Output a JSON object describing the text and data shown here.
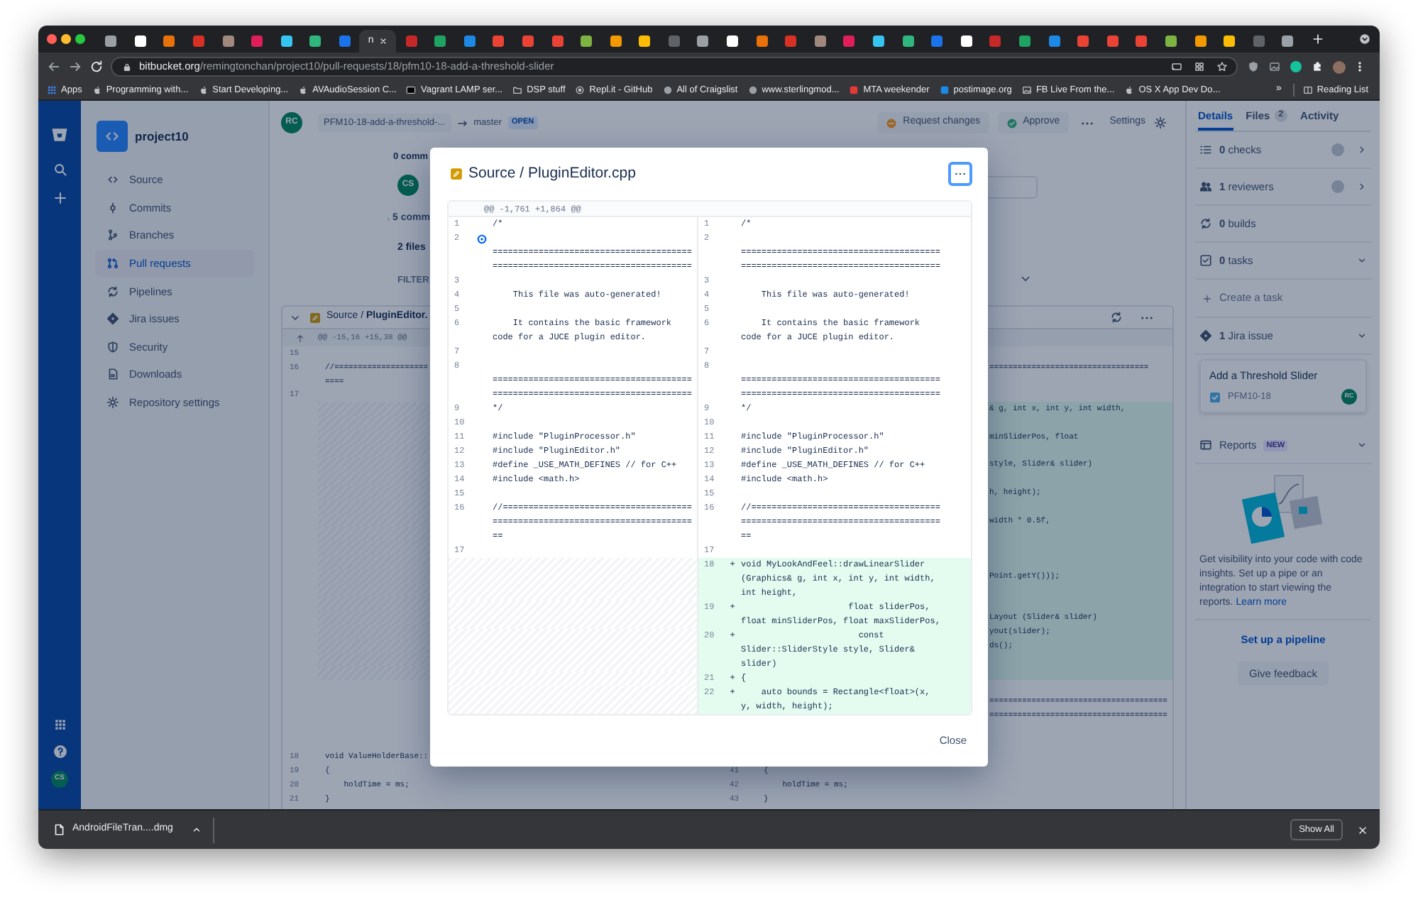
{
  "browser": {
    "tabs": [
      {
        "selected": false
      },
      {
        "selected": false
      },
      {
        "selected": false
      },
      {
        "selected": false
      },
      {
        "selected": false
      },
      {
        "selected": false
      },
      {
        "selected": false
      },
      {
        "selected": false
      },
      {
        "selected": false
      },
      {
        "selected": true,
        "label": "n"
      },
      {
        "selected": false
      },
      {
        "selected": false
      },
      {
        "selected": false
      },
      {
        "selected": false
      },
      {
        "selected": false
      },
      {
        "selected": false
      },
      {
        "selected": false
      },
      {
        "selected": false
      },
      {
        "selected": false
      },
      {
        "selected": false
      },
      {
        "selected": false
      },
      {
        "selected": false
      },
      {
        "selected": false
      },
      {
        "selected": false
      },
      {
        "selected": false
      },
      {
        "selected": false
      },
      {
        "selected": false
      },
      {
        "selected": false
      },
      {
        "selected": false
      },
      {
        "selected": false
      },
      {
        "selected": false
      },
      {
        "selected": false
      },
      {
        "selected": false
      },
      {
        "selected": false
      },
      {
        "selected": false
      },
      {
        "selected": false
      },
      {
        "selected": false
      },
      {
        "selected": false
      },
      {
        "selected": false
      },
      {
        "selected": false
      },
      {
        "selected": false
      }
    ],
    "url_host": "bitbucket.org",
    "url_path": "/remingtonchan/project10/pull-requests/18/pfm10-18-add-a-threshold-slider",
    "bookmarks": [
      {
        "label": "Apps",
        "kind": "apps"
      },
      {
        "label": "Programming with...",
        "kind": "apple"
      },
      {
        "label": "Start Developing...",
        "kind": "apple"
      },
      {
        "label": "AVAudioSession C...",
        "kind": "apple"
      },
      {
        "label": "Vagrant LAMP ser...",
        "kind": "box"
      },
      {
        "label": "DSP stuff",
        "kind": "folder"
      },
      {
        "label": "Repl.it - GitHub",
        "kind": "circle"
      },
      {
        "label": "All of Craigslist",
        "kind": "globe"
      },
      {
        "label": "www.sterlingmod...",
        "kind": "globe"
      },
      {
        "label": "MTA weekender",
        "kind": "red"
      },
      {
        "label": "postimage.org",
        "kind": "blue"
      },
      {
        "label": "FB Live From the...",
        "kind": "image"
      },
      {
        "label": "OS X App Dev Do...",
        "kind": "apple"
      }
    ],
    "bookmarks_more": "»",
    "reading_list": "Reading List"
  },
  "nav_rail": {
    "avatar": "CS"
  },
  "sidebar": {
    "project": "project10",
    "items": [
      {
        "label": "Source",
        "kind": "source",
        "selected": false
      },
      {
        "label": "Commits",
        "kind": "commits",
        "selected": false
      },
      {
        "label": "Branches",
        "kind": "branches",
        "selected": false
      },
      {
        "label": "Pull requests",
        "kind": "pull_requests",
        "selected": true
      },
      {
        "label": "Pipelines",
        "kind": "pipelines",
        "selected": false
      },
      {
        "label": "Jira issues",
        "kind": "jira",
        "selected": false
      },
      {
        "label": "Security",
        "kind": "security",
        "selected": false
      },
      {
        "label": "Downloads",
        "kind": "downloads",
        "selected": false
      },
      {
        "label": "Repository settings",
        "kind": "settings",
        "selected": false
      }
    ]
  },
  "pr_header": {
    "author_avatar": "RC",
    "source_branch": "PFM10-18-add-a-threshold-...",
    "target_branch": "master",
    "state": "OPEN",
    "request_changes": "Request changes",
    "approve": "Approve",
    "settings": "Settings"
  },
  "summary": {
    "comments": "0 comm",
    "avatar": "CS",
    "commits": "5 comm",
    "files": "2 files",
    "filter": "FILTER"
  },
  "file_diff": {
    "path": "Source / **PluginEditor.**",
    "hunk": "@@ -15,16 +15,38 @@",
    "rows": [
      {
        "old_no": "15",
        "added": false
      },
      {
        "old_no": "16",
        "old_text": "//====================",
        "new_text": "==================================",
        "kind": "tail",
        "added": false
      },
      {
        "old_text": "====",
        "added": false
      },
      {
        "old_no": "17",
        "added": false
      },
      {
        "new_text": "& g, int x, int y, int width,",
        "kind": "tail",
        "added": true
      },
      {
        "added": true
      },
      {
        "new_text": "minSliderPos, float",
        "kind": "tail",
        "added": true
      },
      {
        "added": true
      },
      {
        "new_text": "style, Slider& slider)",
        "kind": "tail",
        "added": true
      },
      {
        "added": true
      },
      {
        "new_text": "h, height);",
        "kind": "tail",
        "added": true
      },
      {
        "added": true
      },
      {
        "new_text": "width * 0.5f,",
        "kind": "tail",
        "added": true
      },
      {
        "added": true
      },
      {
        "added": true
      },
      {
        "added": true
      },
      {
        "new_text": "Point.getY()));",
        "kind": "tail",
        "added": true
      },
      {
        "added": true
      },
      {
        "added": true
      },
      {
        "new_text": "Layout (Slider& slider)",
        "kind": "tail",
        "added": true
      },
      {
        "new_text": "yout(slider);",
        "kind": "tail",
        "added": true
      },
      {
        "new_text": "ds();",
        "kind": "tail",
        "added": true
      },
      {
        "added": true
      },
      {
        "added": true
      },
      {
        "added": false
      },
      {
        "new_text": "======================================",
        "kind": "tail",
        "added": false
      },
      {
        "new_text": "======================================",
        "kind": "tail",
        "added": false
      },
      {
        "added": false
      },
      {
        "added": false
      },
      {
        "old_no": "18",
        "old_text": "void ValueHolderBase::",
        "added": false
      },
      {
        "old_no": "19",
        "old_text": "{",
        "new_no": "41",
        "new_text": "{",
        "kind": "full",
        "added": false
      },
      {
        "old_no": "20",
        "old_text": "    holdTime = ms;",
        "new_no": "42",
        "new_text": "    holdTime = ms;",
        "kind": "full",
        "added": false
      },
      {
        "old_no": "21",
        "old_text": "}",
        "new_no": "43",
        "new_text": "}",
        "kind": "full",
        "added": false
      }
    ]
  },
  "details_panel": {
    "tabs": [
      {
        "label": "Details",
        "selected": true
      },
      {
        "label": "Files",
        "count": "2",
        "selected": false
      },
      {
        "label": "Activity",
        "selected": false
      }
    ],
    "items": [
      {
        "kind": "checks",
        "text": "**0** checks",
        "indicator": true,
        "expanded": false
      },
      {
        "kind": "reviewers",
        "text": "**1** reviewers",
        "indicator": true,
        "expanded": false
      },
      {
        "kind": "builds",
        "text": "**0** builds",
        "indicator": false
      },
      {
        "kind": "tasks",
        "text": "**0** tasks",
        "indicator": false,
        "expanded": true
      }
    ],
    "create_task": "Create a task",
    "jira": {
      "text": "**1** Jira issue",
      "expanded": true,
      "title": "Add a Threshold Slider",
      "key": "PFM10-18",
      "avatar": "RC"
    },
    "reports": {
      "label": "Reports",
      "badge": "NEW",
      "expanded": true,
      "description": "Get visibility into your code with code insights. Set up a pipe or an integration to start viewing the reports.",
      "link": "Learn more",
      "pipeline_link": "Set up a pipeline",
      "feedback": "Give feedback"
    }
  },
  "modal": {
    "title": "Source / PluginEditor.cpp",
    "hunk": "@@ -1,761 +1,864 @@",
    "close": "Close",
    "rows": [
      {
        "old_no": "1",
        "old_text": "/*",
        "new_no": "1",
        "new_text": "/*",
        "added": false,
        "marker": false
      },
      {
        "old_no": "2",
        "old_text": "  ==============================================================================",
        "new_no": "2",
        "new_text": "  ==============================================================================",
        "added": false,
        "marker": true
      },
      {
        "old_no": "3",
        "new_no": "3",
        "added": false,
        "marker": false
      },
      {
        "old_no": "4",
        "old_text": "    This file was auto-generated!",
        "new_no": "4",
        "new_text": "    This file was auto-generated!",
        "added": false,
        "marker": false
      },
      {
        "old_no": "5",
        "new_no": "5",
        "added": false,
        "marker": false
      },
      {
        "old_no": "6",
        "old_text": "    It contains the basic framework code for a JUCE plugin editor.",
        "new_no": "6",
        "new_text": "    It contains the basic framework code for a JUCE plugin editor.",
        "added": false,
        "marker": false
      },
      {
        "old_no": "7",
        "new_no": "7",
        "added": false,
        "marker": false
      },
      {
        "old_no": "8",
        "old_text": "  ==============================================================================",
        "new_no": "8",
        "new_text": "  ==============================================================================",
        "added": false,
        "marker": false
      },
      {
        "old_no": "9",
        "old_text": "*/",
        "new_no": "9",
        "new_text": "*/",
        "added": false,
        "marker": false
      },
      {
        "old_no": "10",
        "new_no": "10",
        "added": false,
        "marker": false
      },
      {
        "old_no": "11",
        "old_text": "#include \"PluginProcessor.h\"",
        "new_no": "11",
        "new_text": "#include \"PluginProcessor.h\"",
        "added": false,
        "marker": false
      },
      {
        "old_no": "12",
        "old_text": "#include \"PluginEditor.h\"",
        "new_no": "12",
        "new_text": "#include \"PluginEditor.h\"",
        "added": false,
        "marker": false
      },
      {
        "old_no": "13",
        "old_text": "#define _USE_MATH_DEFINES // for C++",
        "new_no": "13",
        "new_text": "#define _USE_MATH_DEFINES // for C++",
        "added": false,
        "marker": false
      },
      {
        "old_no": "14",
        "old_text": "#include <math.h>",
        "new_no": "14",
        "new_text": "#include <math.h>",
        "added": false,
        "marker": false
      },
      {
        "old_no": "15",
        "new_no": "15",
        "added": false,
        "marker": false
      },
      {
        "old_no": "16",
        "old_text": "//==============================================================================",
        "new_no": "16",
        "new_text": "//==============================================================================",
        "added": false,
        "marker": false
      },
      {
        "old_no": "17",
        "new_no": "17",
        "added": false,
        "marker": false
      },
      {
        "new_no": "18",
        "sign": "+",
        "new_text": "void MyLookAndFeel::drawLinearSlider (Graphics& g, int x, int y, int width, int height,",
        "added": true,
        "marker": false
      },
      {
        "new_no": "19",
        "sign": "+",
        "new_text": "                     float sliderPos, float minSliderPos, float maxSliderPos,",
        "added": true,
        "marker": false
      },
      {
        "new_no": "20",
        "sign": "+",
        "new_text": "                       const Slider::SliderStyle style, Slider& slider)",
        "added": true,
        "marker": false
      },
      {
        "new_no": "21",
        "sign": "+",
        "new_text": "{",
        "added": true,
        "marker": false
      },
      {
        "new_no": "22",
        "sign": "+",
        "new_text": "    auto bounds = Rectangle<float>(x, y, width, height);",
        "added": true,
        "marker": false
      }
    ]
  },
  "downloads": {
    "file": "AndroidFileTran....dmg",
    "show_all": "Show All"
  }
}
